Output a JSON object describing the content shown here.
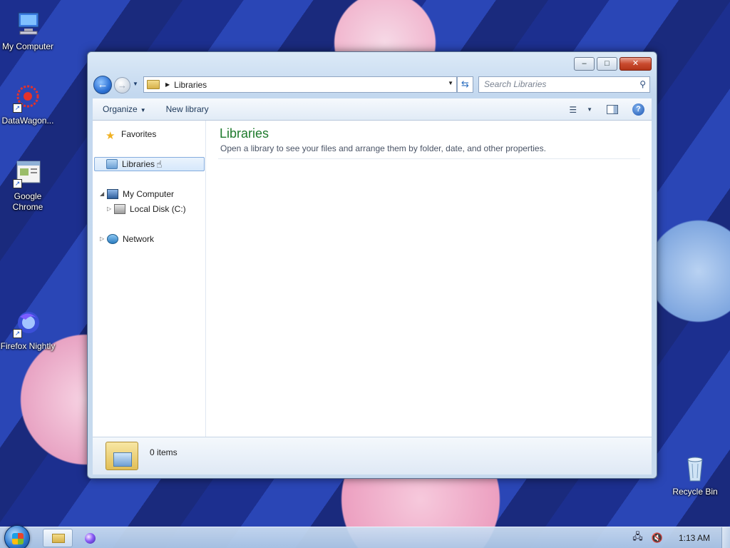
{
  "desktop": {
    "icons": [
      {
        "label": "My Computer"
      },
      {
        "label": "DataWagon..."
      },
      {
        "label": "Google Chrome"
      },
      {
        "label": "Firefox Nightly"
      },
      {
        "label": "Recycle Bin"
      }
    ]
  },
  "window": {
    "caption": {
      "minimize": "–",
      "maximize": "□",
      "close": "✕"
    },
    "address": {
      "path": "Libraries"
    },
    "search": {
      "placeholder": "Search Libraries"
    },
    "toolbar": {
      "organize": "Organize",
      "new_library": "New library"
    },
    "nav_pane": {
      "favorites": "Favorites",
      "libraries": "Libraries",
      "my_computer": "My Computer",
      "local_disk": "Local Disk (C:)",
      "network": "Network"
    },
    "content": {
      "title": "Libraries",
      "subtitle": "Open a library to see your files and arrange them by folder, date, and other properties."
    },
    "details": {
      "items_count": "0 items"
    }
  },
  "taskbar": {
    "clock": "1:13 AM"
  }
}
